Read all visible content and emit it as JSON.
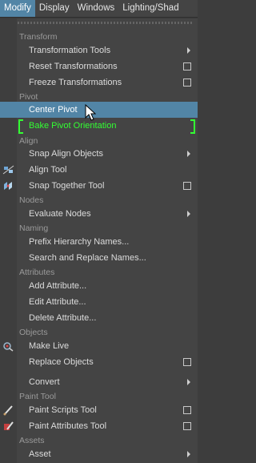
{
  "menubar": {
    "items": [
      "Modify",
      "Display",
      "Windows",
      "Lighting/Shad"
    ],
    "active_index": 0
  },
  "menu": {
    "sections": {
      "transform": "Transform",
      "pivot": "Pivot",
      "align": "Align",
      "nodes": "Nodes",
      "naming": "Naming",
      "attributes": "Attributes",
      "objects": "Objects",
      "paint_tool": "Paint Tool",
      "assets": "Assets"
    },
    "items": {
      "transformation_tools": "Transformation Tools",
      "reset_transformations": "Reset Transformations",
      "freeze_transformations": "Freeze Transformations",
      "center_pivot": "Center Pivot",
      "bake_pivot_orientation": "Bake Pivot Orientation",
      "snap_align_objects": "Snap Align Objects",
      "align_tool": "Align Tool",
      "snap_together_tool": "Snap Together Tool",
      "evaluate_nodes": "Evaluate Nodes",
      "prefix_hierarchy_names": "Prefix Hierarchy Names...",
      "search_replace_names": "Search and Replace Names...",
      "add_attribute": "Add Attribute...",
      "edit_attribute": "Edit Attribute...",
      "delete_attribute": "Delete Attribute...",
      "make_live": "Make Live",
      "replace_objects": "Replace Objects",
      "convert": "Convert",
      "paint_scripts_tool": "Paint Scripts Tool",
      "paint_attributes_tool": "Paint Attributes Tool",
      "asset": "Asset"
    },
    "icons": [
      "align-tool-icon",
      "snap-together-icon",
      "make-live-icon",
      "paint-scripts-icon",
      "paint-attributes-icon"
    ]
  },
  "colors": {
    "highlight": "#5285a6",
    "marked_item": "#33ff33",
    "background": "#444444"
  }
}
